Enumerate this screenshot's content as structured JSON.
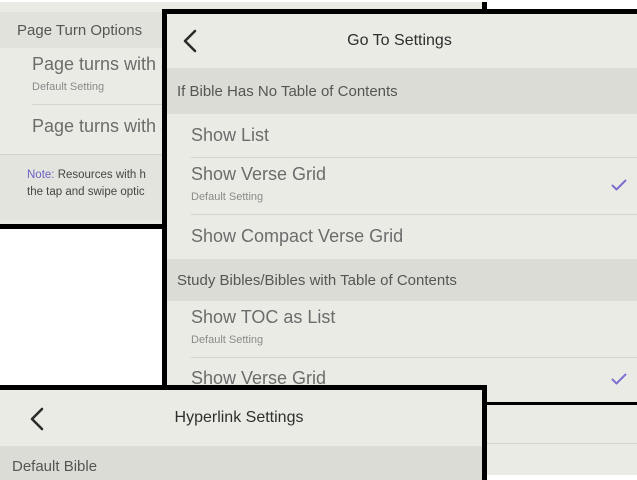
{
  "page_turn": {
    "section": "Page Turn Options",
    "items": [
      {
        "label": "Page turns with s",
        "sub": "Default Setting"
      },
      {
        "label": "Page turns with s"
      }
    ],
    "note_prefix": "Note:",
    "note_line1": " Resources with h",
    "note_line2": "the tap and swipe optic"
  },
  "goto": {
    "title": "Go To Settings",
    "section1": "If Bible Has No Table of Contents",
    "items1": [
      {
        "label": "Show List"
      },
      {
        "label": "Show Verse Grid",
        "sub": "Default Setting",
        "checked": true
      },
      {
        "label": "Show Compact Verse Grid"
      }
    ],
    "section2": "Study Bibles/Bibles with Table of Contents",
    "items2": [
      {
        "label": "Show TOC as List",
        "sub": "Default Setting"
      },
      {
        "label": "Show Verse Grid",
        "checked": true
      }
    ]
  },
  "hyperlink": {
    "title": "Hyperlink Settings",
    "section": "Default Bible"
  },
  "colors": {
    "check": "#7b6fd0",
    "note_prefix": "#6b62c4"
  },
  "icons": [
    "back-chevron-icon",
    "checkmark-icon"
  ]
}
